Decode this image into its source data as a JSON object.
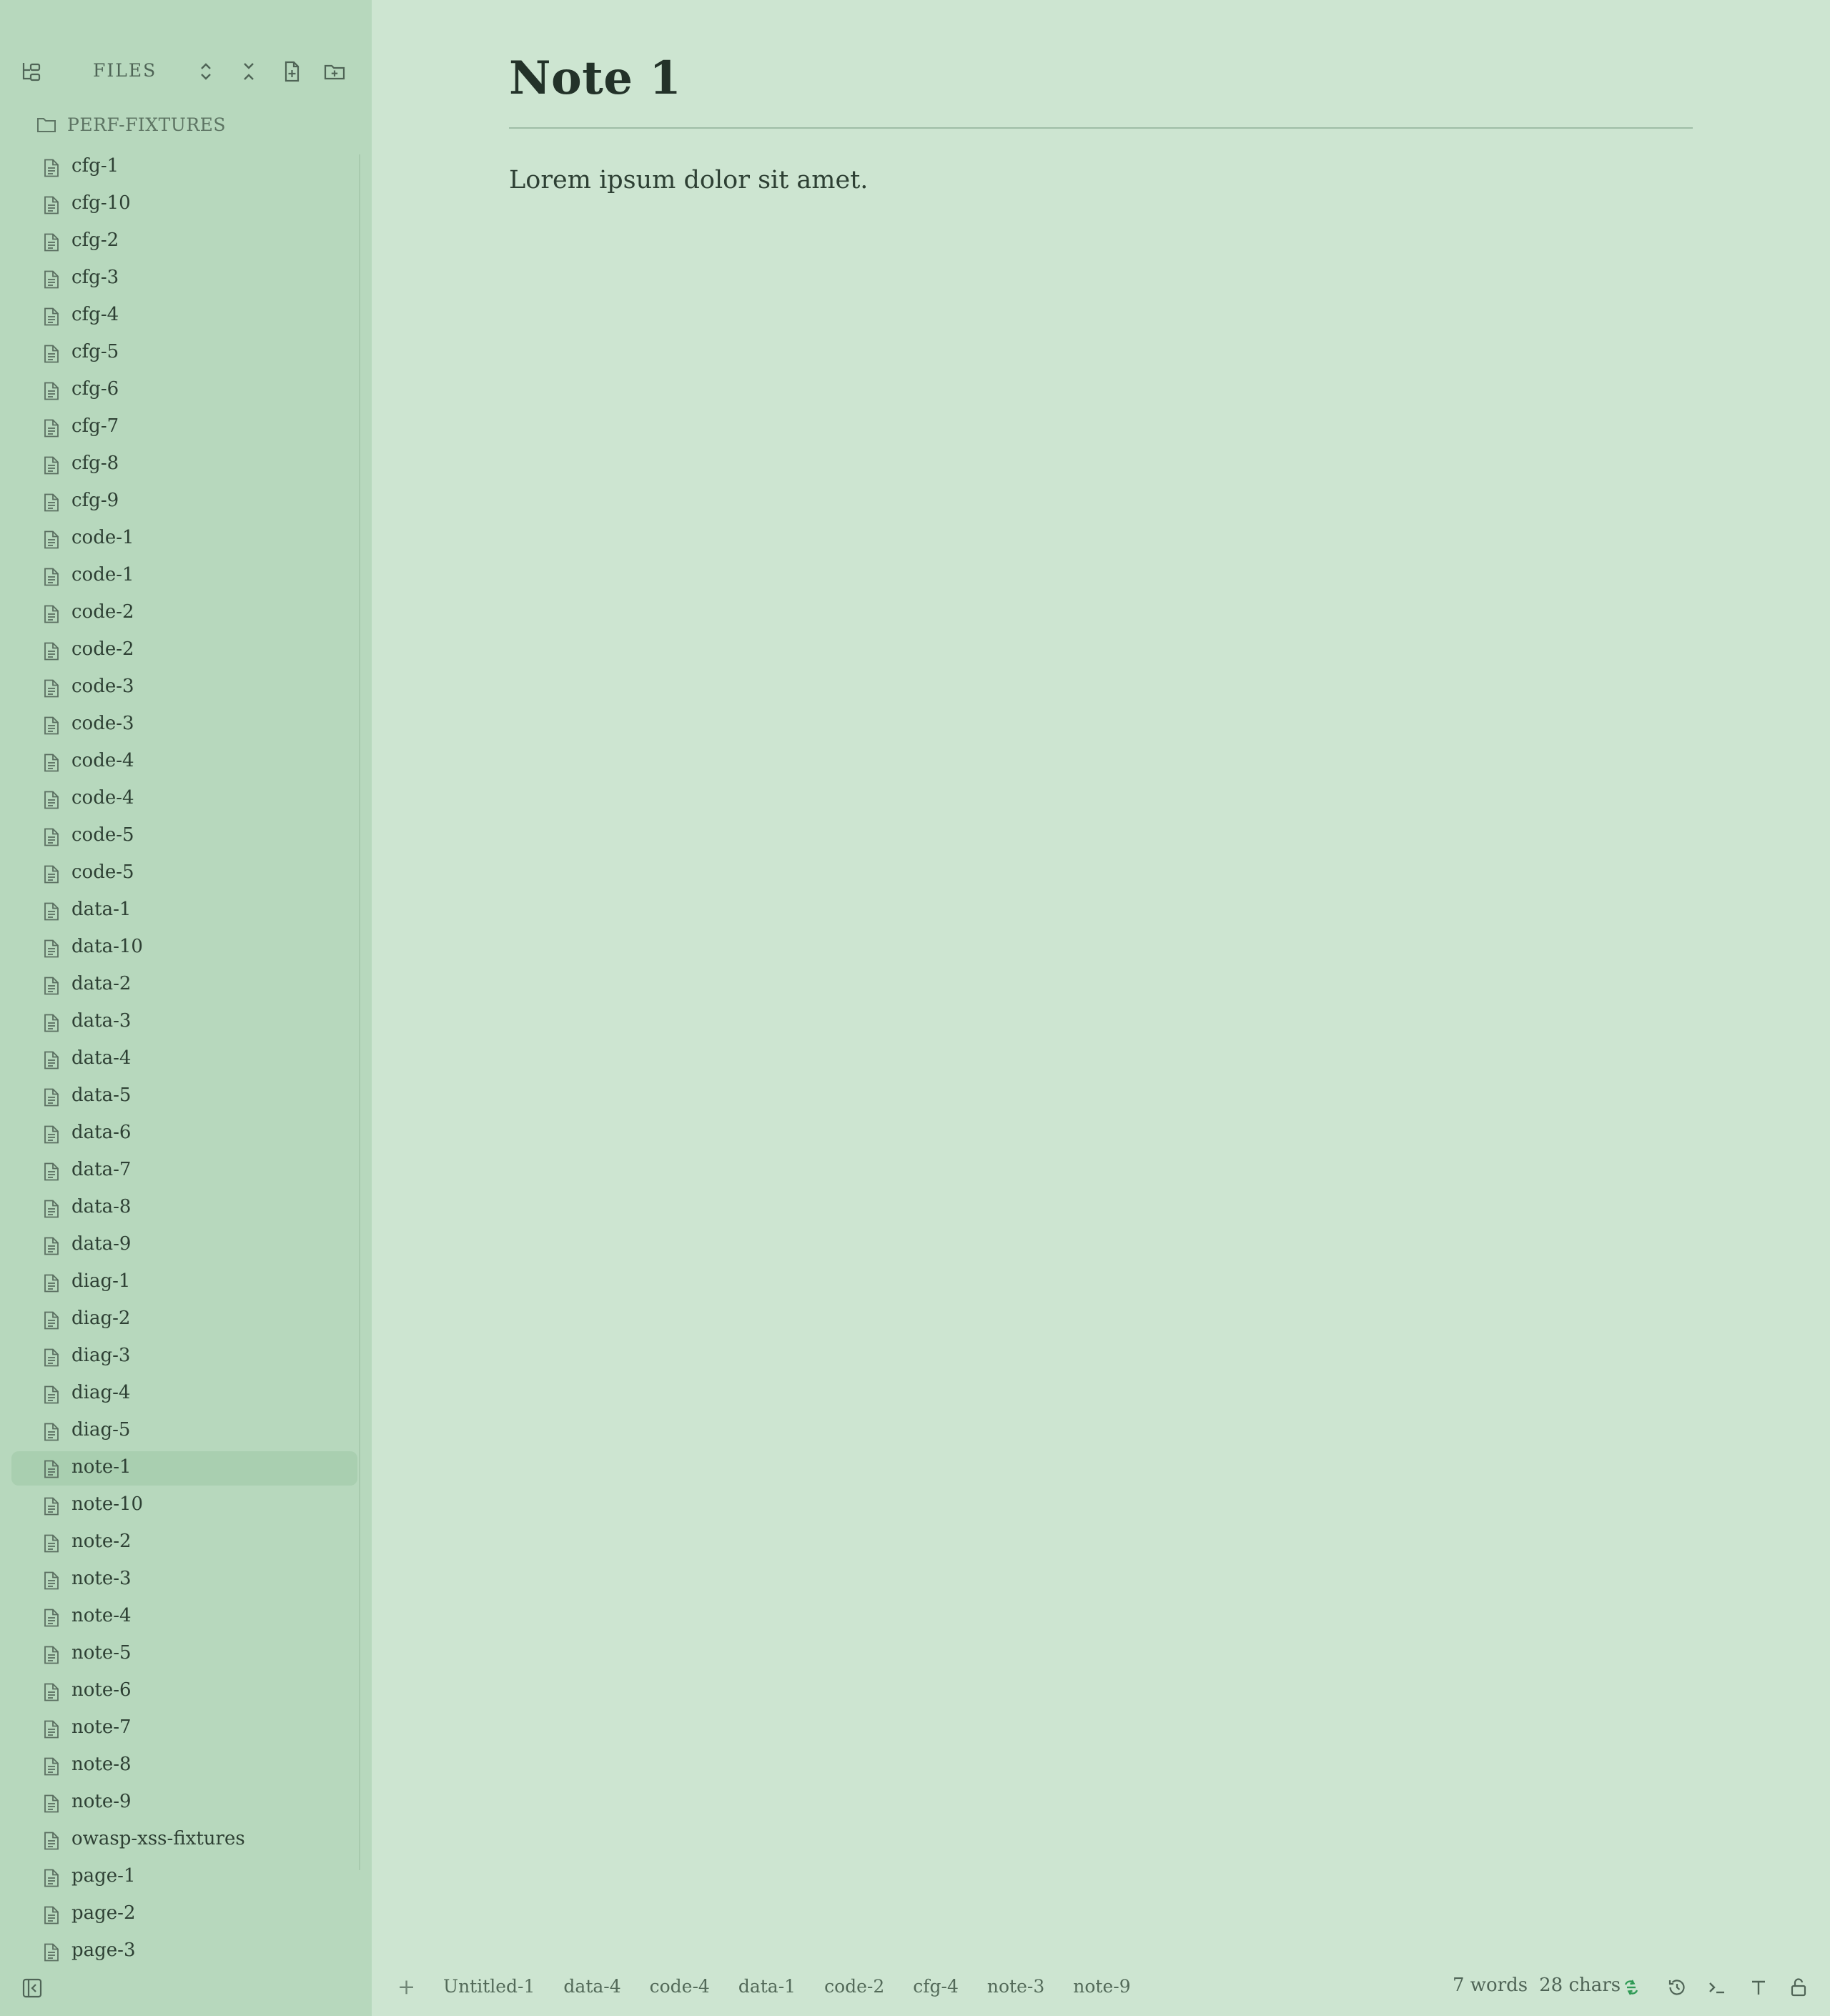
{
  "sidebar": {
    "title": "FILES",
    "folder": "PERF-FIXTURES",
    "files": [
      "cfg-1",
      "cfg-10",
      "cfg-2",
      "cfg-3",
      "cfg-4",
      "cfg-5",
      "cfg-6",
      "cfg-7",
      "cfg-8",
      "cfg-9",
      "code-1",
      "code-1",
      "code-2",
      "code-2",
      "code-3",
      "code-3",
      "code-4",
      "code-4",
      "code-5",
      "code-5",
      "data-1",
      "data-10",
      "data-2",
      "data-3",
      "data-4",
      "data-5",
      "data-6",
      "data-7",
      "data-8",
      "data-9",
      "diag-1",
      "diag-2",
      "diag-3",
      "diag-4",
      "diag-5",
      "note-1",
      "note-10",
      "note-2",
      "note-3",
      "note-4",
      "note-5",
      "note-6",
      "note-7",
      "note-8",
      "note-9",
      "owasp-xss-fixtures",
      "page-1",
      "page-2",
      "page-3"
    ],
    "active_file": "note-1"
  },
  "document": {
    "title": "Note 1",
    "body": "Lorem ipsum dolor sit amet."
  },
  "statusbar": {
    "add_tab": "+",
    "tabs": [
      "Untitled-1",
      "data-4",
      "code-4",
      "data-1",
      "code-2",
      "cfg-4",
      "note-3",
      "note-9"
    ],
    "words": "7 words",
    "chars": "28 chars"
  },
  "colors": {
    "background": "#cde5d1",
    "sidebar": "#b7d8bd",
    "active_row": "#a9cfb0",
    "sync_accent": "#2f9a55"
  },
  "icons": [
    "tree-view-icon",
    "expand-all-icon",
    "collapse-all-icon",
    "new-file-icon",
    "new-folder-icon",
    "folder-icon",
    "file-icon",
    "sidebar-toggle-icon",
    "sync-icon",
    "history-icon",
    "terminal-icon",
    "text-format-icon",
    "lock-icon"
  ]
}
